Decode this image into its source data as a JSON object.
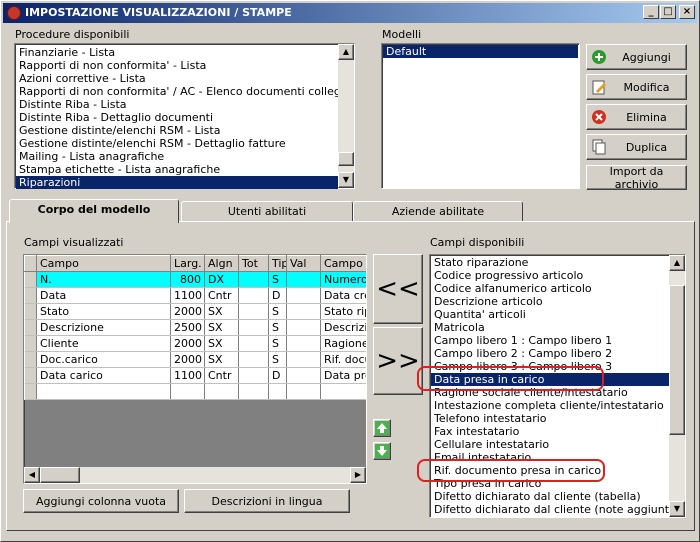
{
  "window": {
    "title": "IMPOSTAZIONE VISUALIZZAZIONI / STAMPE",
    "minimize": "_",
    "maximize": "□",
    "close": "×"
  },
  "procedures": {
    "label": "Procedure disponibili",
    "items": [
      "Finanziarie - Lista",
      "Rapporti di non conformita' - Lista",
      "Azioni correttive - Lista",
      "Rapporti di non conformita' / AC - Elenco documenti collegati",
      "Distinte Riba - Lista",
      "Distinte Riba - Dettaglio documenti",
      "Gestione distinte/elenchi RSM - Lista",
      "Gestione distinte/elenchi RSM - Dettaglio fatture",
      "Mailing - Lista anagrafiche",
      "Stampa etichette - Lista anagrafiche",
      "Riparazioni"
    ],
    "selected": "Riparazioni"
  },
  "models": {
    "label": "Modelli",
    "items": [
      "Default"
    ]
  },
  "buttons": {
    "add": "Aggiungi",
    "edit": "Modifica",
    "delete": "Elimina",
    "duplicate": "Duplica",
    "import": "Import da archivio",
    "add_empty_col": "Aggiungi colonna vuota",
    "descriptions": "Descrizioni in lingua",
    "move_left": "<<",
    "move_right": ">>"
  },
  "tabs": [
    "Corpo del modello",
    "Utenti abilitati",
    "Aziende abilitate"
  ],
  "visible_fields": {
    "label": "Campi visualizzati",
    "headers": [
      "Campo",
      "Larg.",
      "Algn",
      "Tot",
      "Tip",
      "Val",
      "Campo"
    ],
    "rows": [
      [
        "N.",
        "800",
        "DX",
        "",
        "S",
        "",
        "Numero rip"
      ],
      [
        "Data",
        "1100",
        "Cntr",
        "",
        "D",
        "",
        "Data creaz"
      ],
      [
        "Stato",
        "2000",
        "SX",
        "",
        "S",
        "",
        "Stato ripar"
      ],
      [
        "Descrizione",
        "2500",
        "SX",
        "",
        "S",
        "",
        "Descrizion"
      ],
      [
        "Cliente",
        "2000",
        "SX",
        "",
        "S",
        "",
        "Ragione s"
      ],
      [
        "Doc.carico",
        "2000",
        "SX",
        "",
        "S",
        "",
        "Rif. docum"
      ],
      [
        "Data carico",
        "1100",
        "Cntr",
        "",
        "D",
        "",
        "Data presa"
      ]
    ]
  },
  "available_fields": {
    "label": "Campi disponibili",
    "items": [
      "Stato riparazione",
      "Codice progressivo articolo",
      "Codice alfanumerico articolo",
      "Descrizione articolo",
      "Quantita' articoli",
      "Matricola",
      "Campo libero 1 : Campo libero 1",
      "Campo libero 2 : Campo libero 2",
      "Campo libero 3 : Campo libero 3",
      "Data presa in carico",
      "Ragione sociale cliente/intestatario",
      "Intestazione completa cliente/intestatario",
      "Telefono intestatario",
      "Fax intestatario",
      "Cellulare intestatario",
      "Email intestatario",
      "Rif. documento presa in carico",
      "Tipo presa in carico",
      "Difetto dichiarato dal cliente (tabella)",
      "Difetto dichiarato dal cliente (note aggiuntive)"
    ],
    "selected": "Data presa in carico"
  },
  "colors": {
    "title_start": "#0a246a",
    "title_end": "#a6caf0",
    "selection": "#0a246a",
    "highlight_row": "#00ffff",
    "annotation": "#e02020"
  }
}
